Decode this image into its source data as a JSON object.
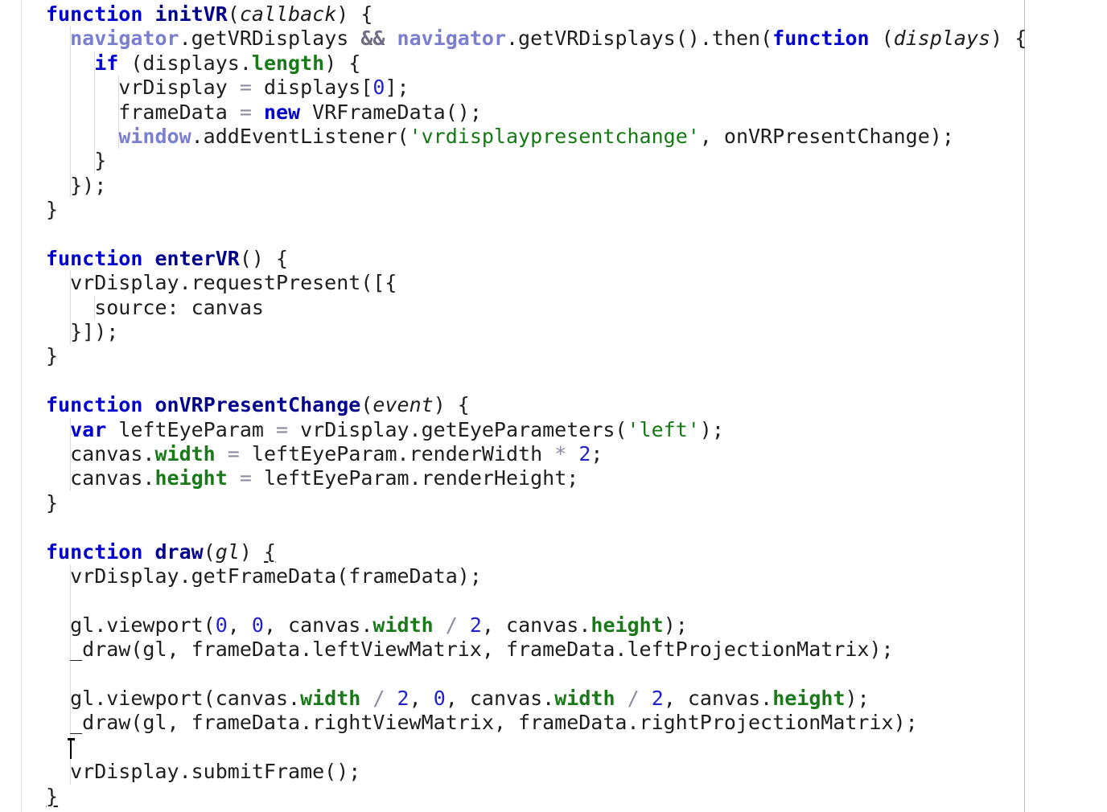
{
  "editor": {
    "language": "javascript",
    "background_color": "#ffffff",
    "default_text_color": "#202020",
    "gutter_rule_color": "#e3e3e6",
    "margin_rule_color": "#bfbfc4",
    "indent_guide_color": "#dcdce0",
    "caret_color": "#000000",
    "syntax_colors": {
      "keyword": "#0000d0",
      "function_name": "#00008f",
      "parameter_italic": "#1e1e1e",
      "global_object": "#7a7fd0",
      "property": "#1a7a1a",
      "string": "#137a13",
      "number": "#2222cc",
      "operator": "#8c8c9e",
      "logical_operator": "#6e6e82",
      "plain": "#1e1e1e"
    }
  },
  "code": {
    "lines": [
      {
        "n": 1,
        "tokens": [
          {
            "t": "function",
            "c": "kw"
          },
          {
            "t": " ",
            "c": "plain"
          },
          {
            "t": "initVR",
            "c": "fn"
          },
          {
            "t": "(",
            "c": "plain"
          },
          {
            "t": "callback",
            "c": "param"
          },
          {
            "t": ") {",
            "c": "plain"
          }
        ]
      },
      {
        "n": 2,
        "tokens": [
          {
            "t": "  ",
            "c": "plain"
          },
          {
            "t": "navigator",
            "c": "global"
          },
          {
            "t": ".getVRDisplays ",
            "c": "plain"
          },
          {
            "t": "&&",
            "c": "logic"
          },
          {
            "t": " ",
            "c": "plain"
          },
          {
            "t": "navigator",
            "c": "global"
          },
          {
            "t": ".getVRDisplays().then(",
            "c": "plain"
          },
          {
            "t": "function",
            "c": "kw"
          },
          {
            "t": " (",
            "c": "plain"
          },
          {
            "t": "displays",
            "c": "param"
          },
          {
            "t": ") {",
            "c": "plain"
          }
        ]
      },
      {
        "n": 3,
        "tokens": [
          {
            "t": "    ",
            "c": "plain"
          },
          {
            "t": "if",
            "c": "kw"
          },
          {
            "t": " (displays.",
            "c": "plain"
          },
          {
            "t": "length",
            "c": "prop"
          },
          {
            "t": ") {",
            "c": "plain"
          }
        ]
      },
      {
        "n": 4,
        "tokens": [
          {
            "t": "      vrDisplay ",
            "c": "plain"
          },
          {
            "t": "=",
            "c": "op"
          },
          {
            "t": " displays[",
            "c": "plain"
          },
          {
            "t": "0",
            "c": "num"
          },
          {
            "t": "];",
            "c": "plain"
          }
        ]
      },
      {
        "n": 5,
        "tokens": [
          {
            "t": "      frameData ",
            "c": "plain"
          },
          {
            "t": "=",
            "c": "op"
          },
          {
            "t": " ",
            "c": "plain"
          },
          {
            "t": "new",
            "c": "kw"
          },
          {
            "t": " VRFrameData();",
            "c": "plain"
          }
        ]
      },
      {
        "n": 6,
        "tokens": [
          {
            "t": "      ",
            "c": "plain"
          },
          {
            "t": "window",
            "c": "global"
          },
          {
            "t": ".addEventListener(",
            "c": "plain"
          },
          {
            "t": "'vrdisplaypresentchange'",
            "c": "str"
          },
          {
            "t": ", onVRPresentChange);",
            "c": "plain"
          }
        ]
      },
      {
        "n": 7,
        "tokens": [
          {
            "t": "    }",
            "c": "plain"
          }
        ]
      },
      {
        "n": 8,
        "tokens": [
          {
            "t": "  });",
            "c": "plain"
          }
        ]
      },
      {
        "n": 9,
        "tokens": [
          {
            "t": "}",
            "c": "plain"
          }
        ]
      },
      {
        "n": 10,
        "tokens": []
      },
      {
        "n": 11,
        "tokens": [
          {
            "t": "function",
            "c": "kw"
          },
          {
            "t": " ",
            "c": "plain"
          },
          {
            "t": "enterVR",
            "c": "fn"
          },
          {
            "t": "() {",
            "c": "plain"
          }
        ]
      },
      {
        "n": 12,
        "tokens": [
          {
            "t": "  vrDisplay.requestPresent([{",
            "c": "plain"
          }
        ]
      },
      {
        "n": 13,
        "tokens": [
          {
            "t": "    source: canvas",
            "c": "plain"
          }
        ]
      },
      {
        "n": 14,
        "tokens": [
          {
            "t": "  }]);",
            "c": "plain"
          }
        ]
      },
      {
        "n": 15,
        "tokens": [
          {
            "t": "}",
            "c": "plain"
          }
        ]
      },
      {
        "n": 16,
        "tokens": []
      },
      {
        "n": 17,
        "tokens": [
          {
            "t": "function",
            "c": "kw"
          },
          {
            "t": " ",
            "c": "plain"
          },
          {
            "t": "onVRPresentChange",
            "c": "fn"
          },
          {
            "t": "(",
            "c": "plain"
          },
          {
            "t": "event",
            "c": "param"
          },
          {
            "t": ") {",
            "c": "plain"
          }
        ]
      },
      {
        "n": 18,
        "tokens": [
          {
            "t": "  ",
            "c": "plain"
          },
          {
            "t": "var",
            "c": "kw"
          },
          {
            "t": " leftEyeParam ",
            "c": "plain"
          },
          {
            "t": "=",
            "c": "op"
          },
          {
            "t": " vrDisplay.getEyeParameters(",
            "c": "plain"
          },
          {
            "t": "'left'",
            "c": "str"
          },
          {
            "t": ");",
            "c": "plain"
          }
        ]
      },
      {
        "n": 19,
        "tokens": [
          {
            "t": "  canvas.",
            "c": "plain"
          },
          {
            "t": "width",
            "c": "prop"
          },
          {
            "t": " ",
            "c": "plain"
          },
          {
            "t": "=",
            "c": "op"
          },
          {
            "t": " leftEyeParam.renderWidth ",
            "c": "plain"
          },
          {
            "t": "*",
            "c": "op"
          },
          {
            "t": " ",
            "c": "plain"
          },
          {
            "t": "2",
            "c": "num"
          },
          {
            "t": ";",
            "c": "plain"
          }
        ]
      },
      {
        "n": 20,
        "tokens": [
          {
            "t": "  canvas.",
            "c": "plain"
          },
          {
            "t": "height",
            "c": "prop"
          },
          {
            "t": " ",
            "c": "plain"
          },
          {
            "t": "=",
            "c": "op"
          },
          {
            "t": " leftEyeParam.renderHeight;",
            "c": "plain"
          }
        ]
      },
      {
        "n": 21,
        "tokens": [
          {
            "t": "}",
            "c": "plain"
          }
        ]
      },
      {
        "n": 22,
        "tokens": []
      },
      {
        "n": 23,
        "tokens": [
          {
            "t": "function",
            "c": "kw"
          },
          {
            "t": " ",
            "c": "plain"
          },
          {
            "t": "draw",
            "c": "fn"
          },
          {
            "t": "(",
            "c": "plain"
          },
          {
            "t": "gl",
            "c": "param"
          },
          {
            "t": ") ",
            "c": "plain"
          },
          {
            "t": "{",
            "c": "plain",
            "match": true
          }
        ]
      },
      {
        "n": 24,
        "tokens": [
          {
            "t": "  vrDisplay.getFrameData(frameData);",
            "c": "plain"
          }
        ]
      },
      {
        "n": 25,
        "tokens": []
      },
      {
        "n": 26,
        "tokens": [
          {
            "t": "  gl.viewport(",
            "c": "plain"
          },
          {
            "t": "0",
            "c": "num"
          },
          {
            "t": ", ",
            "c": "plain"
          },
          {
            "t": "0",
            "c": "num"
          },
          {
            "t": ", canvas.",
            "c": "plain"
          },
          {
            "t": "width",
            "c": "prop"
          },
          {
            "t": " ",
            "c": "plain"
          },
          {
            "t": "/",
            "c": "op"
          },
          {
            "t": " ",
            "c": "plain"
          },
          {
            "t": "2",
            "c": "num"
          },
          {
            "t": ", canvas.",
            "c": "plain"
          },
          {
            "t": "height",
            "c": "prop"
          },
          {
            "t": ");",
            "c": "plain"
          }
        ]
      },
      {
        "n": 27,
        "tokens": [
          {
            "t": "  _draw(gl, frameData.leftViewMatrix, frameData.leftProjectionMatrix);",
            "c": "plain"
          }
        ]
      },
      {
        "n": 28,
        "tokens": []
      },
      {
        "n": 29,
        "tokens": [
          {
            "t": "  gl.viewport(canvas.",
            "c": "plain"
          },
          {
            "t": "width",
            "c": "prop"
          },
          {
            "t": " ",
            "c": "plain"
          },
          {
            "t": "/",
            "c": "op"
          },
          {
            "t": " ",
            "c": "plain"
          },
          {
            "t": "2",
            "c": "num"
          },
          {
            "t": ", ",
            "c": "plain"
          },
          {
            "t": "0",
            "c": "num"
          },
          {
            "t": ", canvas.",
            "c": "plain"
          },
          {
            "t": "width",
            "c": "prop"
          },
          {
            "t": " ",
            "c": "plain"
          },
          {
            "t": "/",
            "c": "op"
          },
          {
            "t": " ",
            "c": "plain"
          },
          {
            "t": "2",
            "c": "num"
          },
          {
            "t": ", canvas.",
            "c": "plain"
          },
          {
            "t": "height",
            "c": "prop"
          },
          {
            "t": ");",
            "c": "plain"
          }
        ]
      },
      {
        "n": 30,
        "tokens": [
          {
            "t": "  _draw(gl, frameData.rightViewMatrix, frameData.rightProjectionMatrix);",
            "c": "plain"
          }
        ]
      },
      {
        "n": 31,
        "tokens": [],
        "caret": true,
        "caret_col": 2
      },
      {
        "n": 32,
        "tokens": [
          {
            "t": "  vrDisplay.submitFrame();",
            "c": "plain"
          }
        ]
      },
      {
        "n": 33,
        "tokens": [
          {
            "t": "}",
            "c": "plain",
            "match": true
          }
        ]
      }
    ]
  },
  "indent_guides": [
    {
      "col": 1,
      "from_line": 2,
      "to_line": 8
    },
    {
      "col": 2,
      "from_line": 3,
      "to_line": 7
    },
    {
      "col": 3,
      "from_line": 4,
      "to_line": 6
    },
    {
      "col": 1,
      "from_line": 12,
      "to_line": 14
    },
    {
      "col": 2,
      "from_line": 13,
      "to_line": 13
    },
    {
      "col": 1,
      "from_line": 18,
      "to_line": 20
    },
    {
      "col": 1,
      "from_line": 24,
      "to_line": 32
    }
  ]
}
